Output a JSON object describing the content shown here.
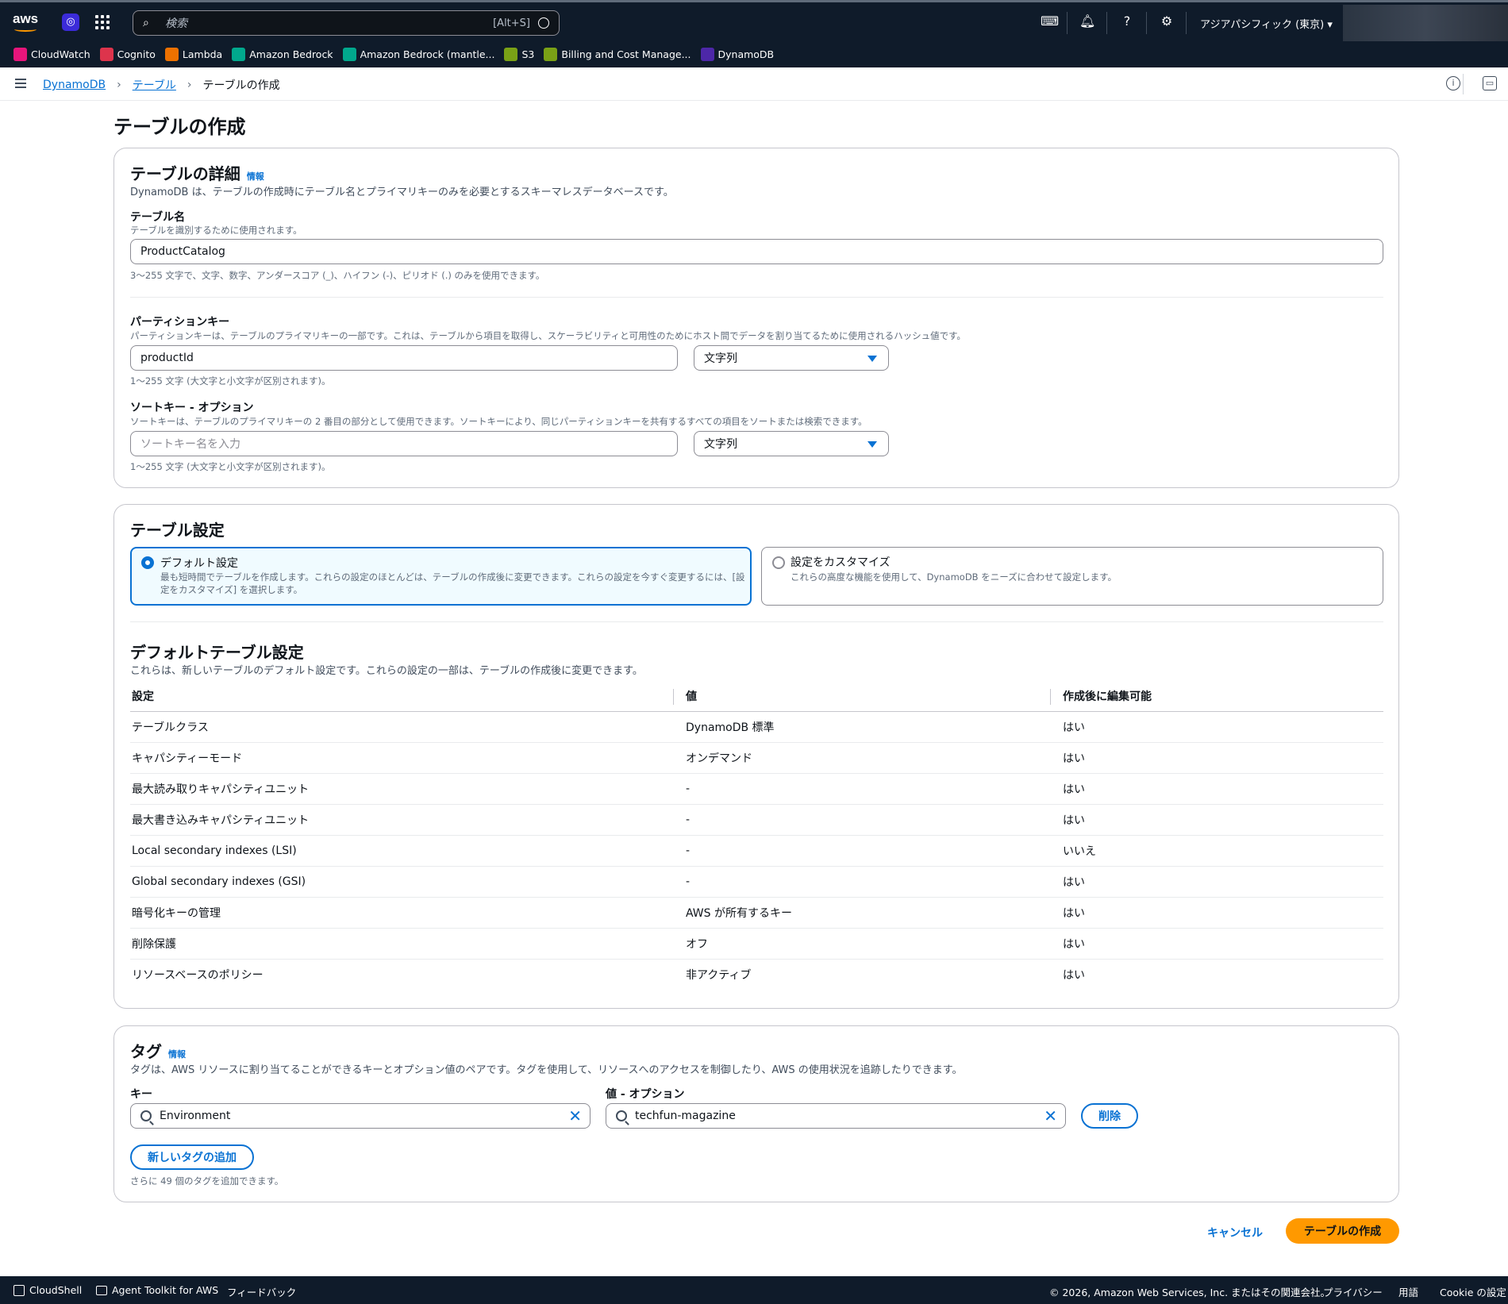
{
  "topbar": {
    "logo_text": "aws",
    "search_placeholder": "検索",
    "search_shortcut": "[Alt+S]",
    "region": "アジアパシフィック (東京) ▾"
  },
  "favorites": [
    {
      "label": "CloudWatch",
      "color": "#e7157b"
    },
    {
      "label": "Cognito",
      "color": "#dd344c"
    },
    {
      "label": "Lambda",
      "color": "#ed7100"
    },
    {
      "label": "Amazon Bedrock",
      "color": "#01a88d"
    },
    {
      "label": "Amazon Bedrock (mantle...",
      "color": "#01a88d"
    },
    {
      "label": "S3",
      "color": "#7aa116"
    },
    {
      "label": "Billing and Cost Manage...",
      "color": "#7aa116"
    },
    {
      "label": "DynamoDB",
      "color": "#4d27a8"
    }
  ],
  "breadcrumb": {
    "items": [
      "DynamoDB",
      "テーブル"
    ],
    "current": "テーブルの作成"
  },
  "page_title": "テーブルの作成",
  "details": {
    "title": "テーブルの詳細",
    "info": "情報",
    "description": "DynamoDB は、テーブルの作成時にテーブル名とプライマリキーのみを必要とするスキーマレスデータベースです。",
    "table_name_label": "テーブル名",
    "table_name_sub": "テーブルを識別するために使用されます。",
    "table_name_value": "ProductCatalog",
    "table_name_hint": "3〜255 文字で、文字、数字、アンダースコア (_)、ハイフン (-)、ピリオド (.) のみを使用できます。",
    "pk_label": "パーティションキー",
    "pk_sub": "パーティションキーは、テーブルのプライマリキーの一部です。これは、テーブルから項目を取得し、スケーラビリティと可用性のためにホスト間でデータを割り当てるために使用されるハッシュ値です。",
    "pk_value": "productId",
    "pk_type": "文字列",
    "pk_hint": "1〜255 文字 (大文字と小文字が区別されます)。",
    "sk_label": "ソートキー - オプション",
    "sk_sub": "ソートキーは、テーブルのプライマリキーの 2 番目の部分として使用できます。ソートキーにより、同じパーティションキーを共有するすべての項目をソートまたは検索できます。",
    "sk_placeholder": "ソートキー名を入力",
    "sk_type": "文字列",
    "sk_hint": "1〜255 文字 (大文字と小文字が区別されます)。"
  },
  "settings": {
    "title": "テーブル設定",
    "default_label": "デフォルト設定",
    "default_desc": "最も短時間でテーブルを作成します。これらの設定のほとんどは、テーブルの作成後に変更できます。これらの設定を今すぐ変更するには、[設定をカスタマイズ] を選択します。",
    "custom_label": "設定をカスタマイズ",
    "custom_desc": "これらの高度な機能を使用して、DynamoDB をニーズに合わせて設定します。",
    "defaults_title": "デフォルトテーブル設定",
    "defaults_desc": "これらは、新しいテーブルのデフォルト設定です。これらの設定の一部は、テーブルの作成後に変更できます。",
    "columns": [
      "設定",
      "値",
      "作成後に編集可能"
    ],
    "rows": [
      [
        "テーブルクラス",
        "DynamoDB 標準",
        "はい"
      ],
      [
        "キャパシティーモード",
        "オンデマンド",
        "はい"
      ],
      [
        "最大読み取りキャパシティユニット",
        "-",
        "はい"
      ],
      [
        "最大書き込みキャパシティユニット",
        "-",
        "はい"
      ],
      [
        "Local secondary indexes (LSI)",
        "-",
        "いいえ"
      ],
      [
        "Global secondary indexes (GSI)",
        "-",
        "はい"
      ],
      [
        "暗号化キーの管理",
        "AWS が所有するキー",
        "はい"
      ],
      [
        "削除保護",
        "オフ",
        "はい"
      ],
      [
        "リソースベースのポリシー",
        "非アクティブ",
        "はい"
      ]
    ]
  },
  "tags": {
    "title": "タグ",
    "info": "情報",
    "description": "タグは、AWS リソースに割り当てることができるキーとオプション値のペアです。タグを使用して、リソースへのアクセスを制御したり、AWS の使用状況を追跡したりできます。",
    "key_label": "キー",
    "value_label": "値 - オプション",
    "key_value": "Environment",
    "value_value": "techfun-magazine",
    "remove_label": "削除",
    "add_label": "新しいタグの追加",
    "remaining": "さらに 49 個のタグを追加できます。"
  },
  "actions": {
    "cancel": "キャンセル",
    "create": "テーブルの作成"
  },
  "footer": {
    "cloudshell": "CloudShell",
    "agent_toolkit": "Agent Toolkit for AWS",
    "feedback": "フィードバック",
    "copyright": "© 2026, Amazon Web Services, Inc. またはその関連会社。",
    "privacy": "プライバシー",
    "terms": "用語",
    "cookie": "Cookie の設定"
  }
}
